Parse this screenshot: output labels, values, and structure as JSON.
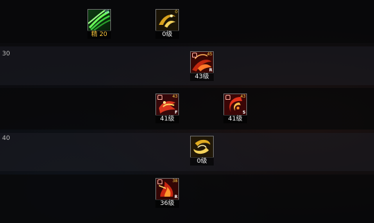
{
  "rows": [
    {
      "label": ""
    },
    {
      "label": "30"
    },
    {
      "label": ""
    },
    {
      "label": "40"
    },
    {
      "label": ""
    }
  ],
  "skills": [
    {
      "id": "wind",
      "level_text": "精 20",
      "badge": "25",
      "lock": false,
      "letter": ""
    },
    {
      "id": "gold-swirl-top",
      "level_text": "0级",
      "badge": "0",
      "lock": false,
      "letter": ""
    },
    {
      "id": "red-wave",
      "level_text": "43级",
      "badge": "45",
      "lock": true,
      "letter": "R"
    },
    {
      "id": "red-claw",
      "level_text": "41级",
      "badge": "43",
      "lock": true,
      "letter": "F"
    },
    {
      "id": "red-crescent",
      "level_text": "41级",
      "badge": "43",
      "lock": true,
      "letter": "S"
    },
    {
      "id": "gold-swirl-bottom",
      "level_text": "0级",
      "badge": "",
      "lock": false,
      "letter": ""
    },
    {
      "id": "red-flame",
      "level_text": "36级",
      "badge": "38",
      "lock": true,
      "letter": "R"
    }
  ],
  "colors": {
    "background": "#0b0b0e",
    "level_text": "#f0f0f0",
    "rank_text": "#f2c03a",
    "icon_border": "#6b6b6b"
  }
}
